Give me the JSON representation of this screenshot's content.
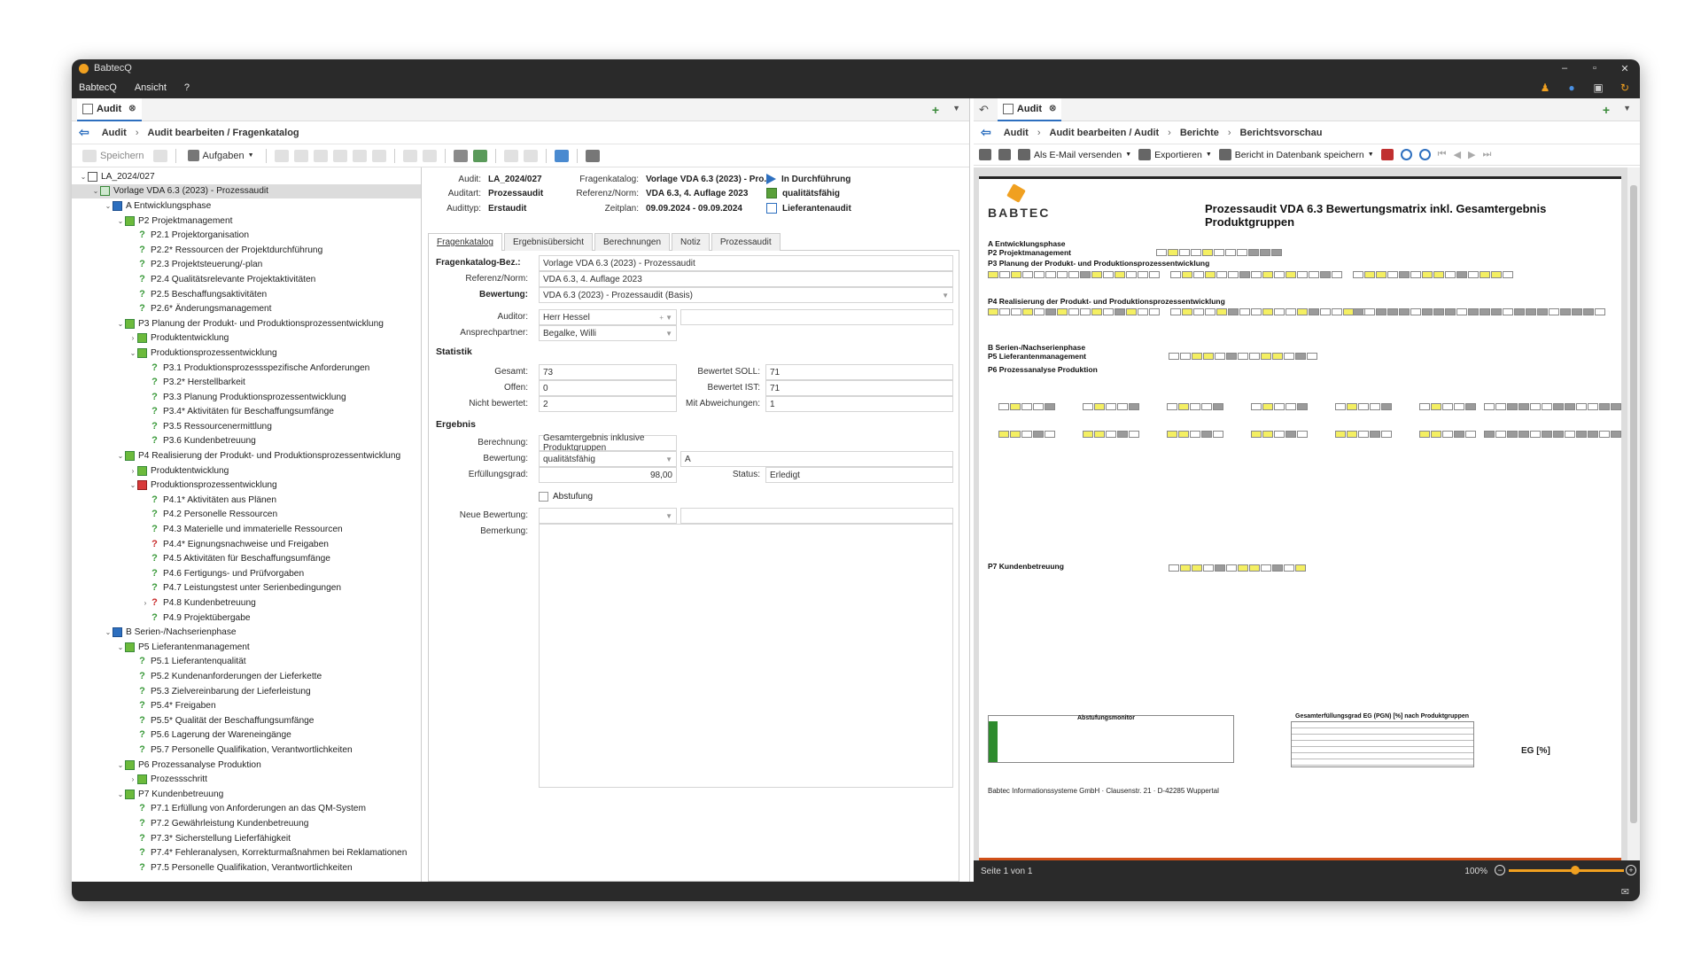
{
  "app": {
    "title": "BabtecQ",
    "window_controls": [
      "–",
      "▫",
      "✕"
    ]
  },
  "menu": [
    "BabtecQ",
    "Ansicht",
    "?"
  ],
  "left": {
    "tab": "Audit",
    "breadcrumb": [
      "Audit",
      "Audit bearbeiten / Fragenkatalog"
    ],
    "toolbar": {
      "save": "Speichern",
      "tasks": "Aufgaben"
    },
    "tree": [
      {
        "d": 0,
        "c": "v",
        "i": "doc",
        "t": "LA_2024/027"
      },
      {
        "d": 1,
        "c": "v",
        "i": "cat",
        "t": "Vorlage VDA 6.3 (2023) - Prozessaudit",
        "sel": true
      },
      {
        "d": 2,
        "c": "v",
        "i": "chp",
        "t": "A Entwicklungsphase"
      },
      {
        "d": 3,
        "c": "v",
        "i": "prc",
        "t": "P2 Projektmanagement"
      },
      {
        "d": 4,
        "c": "",
        "i": "q",
        "t": "P2.1 Projektorganisation"
      },
      {
        "d": 4,
        "c": "",
        "i": "q",
        "t": "P2.2* Ressourcen der Projektdurchführung"
      },
      {
        "d": 4,
        "c": "",
        "i": "q",
        "t": "P2.3 Projektsteuerung/-plan"
      },
      {
        "d": 4,
        "c": "",
        "i": "q",
        "t": "P2.4 Qualitätsrelevante Projektaktivitäten"
      },
      {
        "d": 4,
        "c": "",
        "i": "q",
        "t": "P2.5 Beschaffungsaktivitäten"
      },
      {
        "d": 4,
        "c": "",
        "i": "q",
        "t": "P2.6* Änderungsmanagement"
      },
      {
        "d": 3,
        "c": "v",
        "i": "prc",
        "t": "P3 Planung der Produkt- und Produktionsprozessentwicklung"
      },
      {
        "d": 4,
        "c": ">",
        "i": "prc",
        "t": "Produktentwicklung"
      },
      {
        "d": 4,
        "c": "v",
        "i": "prc",
        "t": "Produktionsprozessentwicklung"
      },
      {
        "d": 5,
        "c": "",
        "i": "q",
        "t": "P3.1 Produktionsprozessspezifische Anforderungen"
      },
      {
        "d": 5,
        "c": "",
        "i": "q",
        "t": "P3.2* Herstellbarkeit"
      },
      {
        "d": 5,
        "c": "",
        "i": "q",
        "t": "P3.3 Planung Produktionsprozessentwicklung"
      },
      {
        "d": 5,
        "c": "",
        "i": "q",
        "t": "P3.4* Aktivitäten für Beschaffungsumfänge"
      },
      {
        "d": 5,
        "c": "",
        "i": "q",
        "t": "P3.5 Ressourcenermittlung"
      },
      {
        "d": 5,
        "c": "",
        "i": "q",
        "t": "P3.6 Kundenbetreuung"
      },
      {
        "d": 3,
        "c": "v",
        "i": "prc",
        "t": "P4 Realisierung der Produkt- und Produktionsprozessentwicklung"
      },
      {
        "d": 4,
        "c": ">",
        "i": "prc",
        "t": "Produktentwicklung"
      },
      {
        "d": 4,
        "c": "v",
        "i": "prr",
        "t": "Produktionsprozessentwicklung"
      },
      {
        "d": 5,
        "c": "",
        "i": "q",
        "t": "P4.1* Aktivitäten aus Plänen"
      },
      {
        "d": 5,
        "c": "",
        "i": "q",
        "t": "P4.2 Personelle Ressourcen"
      },
      {
        "d": 5,
        "c": "",
        "i": "q",
        "t": "P4.3 Materielle und immaterielle Ressourcen"
      },
      {
        "d": 5,
        "c": "",
        "i": "qr",
        "t": "P4.4* Eignungsnachweise und Freigaben"
      },
      {
        "d": 5,
        "c": "",
        "i": "q",
        "t": "P4.5 Aktivitäten für Beschaffungsumfänge"
      },
      {
        "d": 5,
        "c": "",
        "i": "q",
        "t": "P4.6 Fertigungs- und Prüfvorgaben"
      },
      {
        "d": 5,
        "c": "",
        "i": "q",
        "t": "P4.7 Leistungstest unter Serienbedingungen"
      },
      {
        "d": 5,
        "c": ">",
        "i": "qr",
        "t": "P4.8 Kundenbetreuung"
      },
      {
        "d": 5,
        "c": "",
        "i": "q",
        "t": "P4.9 Projektübergabe"
      },
      {
        "d": 2,
        "c": "v",
        "i": "chp",
        "t": "B Serien-/Nachserienphase"
      },
      {
        "d": 3,
        "c": "v",
        "i": "prc",
        "t": "P5 Lieferantenmanagement"
      },
      {
        "d": 4,
        "c": "",
        "i": "q",
        "t": "P5.1 Lieferantenqualität"
      },
      {
        "d": 4,
        "c": "",
        "i": "q",
        "t": "P5.2 Kundenanforderungen der Lieferkette"
      },
      {
        "d": 4,
        "c": "",
        "i": "q",
        "t": "P5.3 Zielvereinbarung der Lieferleistung"
      },
      {
        "d": 4,
        "c": "",
        "i": "q",
        "t": "P5.4* Freigaben"
      },
      {
        "d": 4,
        "c": "",
        "i": "q",
        "t": "P5.5* Qualität der Beschaffungsumfänge"
      },
      {
        "d": 4,
        "c": "",
        "i": "q",
        "t": "P5.6 Lagerung der Wareneingänge"
      },
      {
        "d": 4,
        "c": "",
        "i": "q",
        "t": "P5.7 Personelle Qualifikation, Verantwortlichkeiten"
      },
      {
        "d": 3,
        "c": "v",
        "i": "prc",
        "t": "P6 Prozessanalyse Produktion"
      },
      {
        "d": 4,
        "c": ">",
        "i": "prc",
        "t": "Prozessschritt"
      },
      {
        "d": 3,
        "c": "v",
        "i": "prc",
        "t": "P7 Kundenbetreuung"
      },
      {
        "d": 4,
        "c": "",
        "i": "q",
        "t": "P7.1 Erfüllung von Anforderungen an das QM-System"
      },
      {
        "d": 4,
        "c": "",
        "i": "q",
        "t": "P7.2 Gewährleistung Kundenbetreuung"
      },
      {
        "d": 4,
        "c": "",
        "i": "q",
        "t": "P7.3* Sicherstellung Lieferfähigkeit"
      },
      {
        "d": 4,
        "c": "",
        "i": "q",
        "t": "P7.4* Fehleranalysen, Korrekturmaßnahmen bei Reklamationen"
      },
      {
        "d": 4,
        "c": "",
        "i": "q",
        "t": "P7.5 Personelle Qualifikation, Verantwortlichkeiten"
      }
    ],
    "header": {
      "audit_l": "Audit:",
      "audit_v": "LA_2024/027",
      "auditart_l": "Auditart:",
      "auditart_v": "Prozessaudit",
      "audittyp_l": "Audittyp:",
      "audittyp_v": "Erstaudit",
      "katalog_l": "Fragenkatalog:",
      "katalog_v": "Vorlage VDA 6.3 (2023) - Pro...",
      "norm_l": "Referenz/Norm:",
      "norm_v": "VDA 6.3, 4. Auflage 2023",
      "zeit_l": "Zeitplan:",
      "zeit_v": "09.09.2024 - 09.09.2024",
      "status1": "In Durchführung",
      "status2": "qualitätsfähig",
      "status3": "Lieferantenaudit"
    },
    "subtabs": [
      "Fragenkatalog",
      "Ergebnisübersicht",
      "Berechnungen",
      "Notiz",
      "Prozessaudit"
    ],
    "form": {
      "bez_l": "Fragenkatalog-Bez.:",
      "bez_v": "Vorlage VDA 6.3 (2023) - Prozessaudit",
      "ref_l": "Referenz/Norm:",
      "ref_v": "VDA 6.3, 4. Auflage 2023",
      "bew_l": "Bewertung:",
      "bew_v": "VDA 6.3 (2023) - Prozessaudit (Basis)",
      "auditor_l": "Auditor:",
      "auditor_v": "Herr Hessel",
      "partner_l": "Ansprechpartner:",
      "partner_v": "Begalke, Willi",
      "stat": "Statistik",
      "gesamt_l": "Gesamt:",
      "gesamt_v": "73",
      "offen_l": "Offen:",
      "offen_v": "0",
      "nicht_l": "Nicht bewertet:",
      "nicht_v": "2",
      "soll_l": "Bewertet SOLL:",
      "soll_v": "71",
      "ist_l": "Bewertet IST:",
      "ist_v": "71",
      "abw_l": "Mit Abweichungen:",
      "abw_v": "1",
      "erg": "Ergebnis",
      "ber_l": "Berechnung:",
      "ber_v": "Gesamtergebnis inklusive Produktgruppen",
      "bew2_l": "Bewertung:",
      "bew2_v": "qualitätsfähig",
      "bew2_c": "A",
      "erf_l": "Erfüllungsgrad:",
      "erf_v": "98,00",
      "status_l": "Status:",
      "status_v": "Erledigt",
      "abst": "Abstufung",
      "neu_l": "Neue Bewertung:",
      "bem_l": "Bemerkung:"
    }
  },
  "right": {
    "tab": "Audit",
    "breadcrumb": [
      "Audit",
      "Audit bearbeiten / Audit",
      "Berichte",
      "Berichtsvorschau"
    ],
    "toolbar": {
      "email": "Als E-Mail versenden",
      "export": "Exportieren",
      "save": "Bericht in Datenbank speichern"
    },
    "report": {
      "logo": "BABTEC",
      "title": "Prozessaudit VDA 6.3 Bewertungsmatrix inkl. Gesamtergebnis Produktgruppen",
      "a": "A Entwicklungsphase",
      "p2": "P2 Projektmanagement",
      "p3": "P3 Planung der Produkt- und Produktionsprozessentwicklung",
      "p4": "P4 Realisierung der Produkt- und Produktionsprozessentwicklung",
      "b": "B Serien-/Nachserienphase",
      "p5": "P5 Lieferantenmanagement",
      "p6": "P6 Prozessanalyse Produktion",
      "p7": "P7 Kundenbetreuung",
      "mon": "Abstufungsmonitor",
      "gtab": "Gesamterfüllungsgrad EG (PGN) [%] nach Produktgruppen",
      "eg": "EG [%]",
      "footer": "Babtec Informationssysteme GmbH · Clausenstr. 21 · D-42285 Wuppertal"
    },
    "page": "Seite 1 von 1",
    "zoom": "100%"
  }
}
